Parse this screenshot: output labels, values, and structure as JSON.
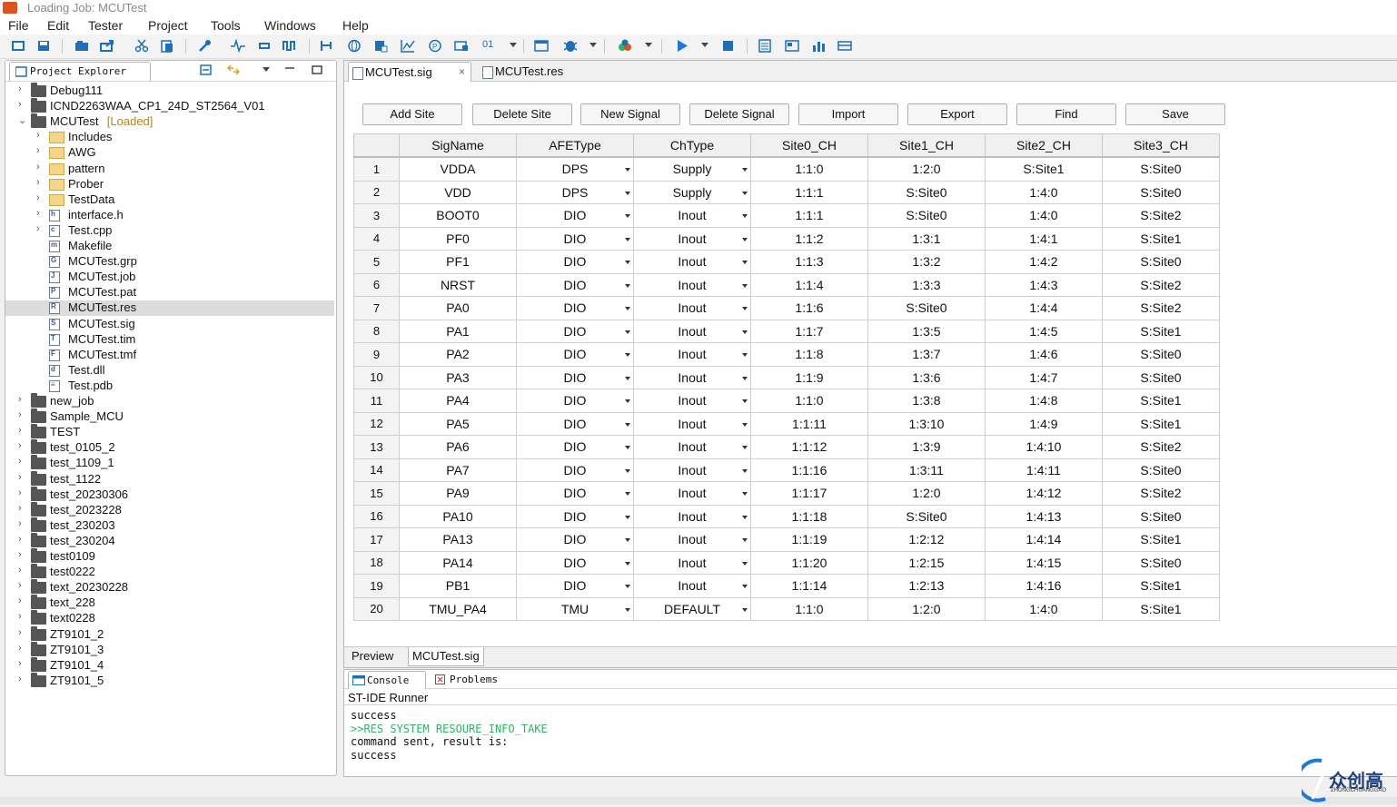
{
  "window": {
    "title": "Loading Job: MCUTest"
  },
  "menu": [
    "File",
    "Edit",
    "Tester",
    "Project",
    "Tools",
    "Windows",
    "Help"
  ],
  "toolbar": {
    "counter_label": "01"
  },
  "explorer": {
    "tab_label": "Project Explorer",
    "items": [
      {
        "label": "Debug111",
        "depth": 0,
        "expander": "collapsed",
        "icon": "project-folder"
      },
      {
        "label": "ICND2263WAA_CP1_24D_ST2564_V01",
        "depth": 0,
        "expander": "collapsed",
        "icon": "project-folder"
      },
      {
        "label": "MCUTest",
        "suffix": "[Loaded]",
        "depth": 0,
        "expander": "expanded",
        "icon": "project-folder"
      },
      {
        "label": "Includes",
        "depth": 1,
        "expander": "collapsed",
        "icon": "includes-folder"
      },
      {
        "label": "AWG",
        "depth": 1,
        "expander": "collapsed",
        "icon": "folder"
      },
      {
        "label": "pattern",
        "depth": 1,
        "expander": "collapsed",
        "icon": "folder"
      },
      {
        "label": "Prober",
        "depth": 1,
        "expander": "collapsed",
        "icon": "folder"
      },
      {
        "label": "TestData",
        "depth": 1,
        "expander": "collapsed",
        "icon": "folder"
      },
      {
        "label": "interface.h",
        "depth": 1,
        "expander": "collapsed",
        "icon": "file-h"
      },
      {
        "label": "Test.cpp",
        "depth": 1,
        "expander": "collapsed",
        "icon": "file-c"
      },
      {
        "label": "Makefile",
        "depth": 1,
        "expander": "none",
        "icon": "makefile"
      },
      {
        "label": "MCUTest.grp",
        "depth": 1,
        "expander": "none",
        "icon": "file-g"
      },
      {
        "label": "MCUTest.job",
        "depth": 1,
        "expander": "none",
        "icon": "file-j"
      },
      {
        "label": "MCUTest.pat",
        "depth": 1,
        "expander": "none",
        "icon": "file-p"
      },
      {
        "label": "MCUTest.res",
        "depth": 1,
        "expander": "none",
        "icon": "file-r",
        "selected": true
      },
      {
        "label": "MCUTest.sig",
        "depth": 1,
        "expander": "none",
        "icon": "file-s"
      },
      {
        "label": "MCUTest.tim",
        "depth": 1,
        "expander": "none",
        "icon": "file-t"
      },
      {
        "label": "MCUTest.tmf",
        "depth": 1,
        "expander": "none",
        "icon": "file-f"
      },
      {
        "label": "Test.dll",
        "depth": 1,
        "expander": "none",
        "icon": "file-dll"
      },
      {
        "label": "Test.pdb",
        "depth": 1,
        "expander": "none",
        "icon": "file-doc"
      },
      {
        "label": "new_job",
        "depth": 0,
        "expander": "collapsed",
        "icon": "project-folder"
      },
      {
        "label": "Sample_MCU",
        "depth": 0,
        "expander": "collapsed",
        "icon": "project-folder"
      },
      {
        "label": "TEST",
        "depth": 0,
        "expander": "collapsed",
        "icon": "project-folder"
      },
      {
        "label": "test_0105_2",
        "depth": 0,
        "expander": "collapsed",
        "icon": "project-folder"
      },
      {
        "label": "test_1109_1",
        "depth": 0,
        "expander": "collapsed",
        "icon": "project-folder"
      },
      {
        "label": "test_1122",
        "depth": 0,
        "expander": "collapsed",
        "icon": "project-folder"
      },
      {
        "label": "test_20230306",
        "depth": 0,
        "expander": "collapsed",
        "icon": "project-folder"
      },
      {
        "label": "test_2023228",
        "depth": 0,
        "expander": "collapsed",
        "icon": "project-folder"
      },
      {
        "label": "test_230203",
        "depth": 0,
        "expander": "collapsed",
        "icon": "project-folder"
      },
      {
        "label": "test_230204",
        "depth": 0,
        "expander": "collapsed",
        "icon": "project-folder"
      },
      {
        "label": "test0109",
        "depth": 0,
        "expander": "collapsed",
        "icon": "project-folder"
      },
      {
        "label": "test0222",
        "depth": 0,
        "expander": "collapsed",
        "icon": "project-folder"
      },
      {
        "label": "text_20230228",
        "depth": 0,
        "expander": "collapsed",
        "icon": "project-folder"
      },
      {
        "label": "text_228",
        "depth": 0,
        "expander": "collapsed",
        "icon": "project-folder"
      },
      {
        "label": "text0228",
        "depth": 0,
        "expander": "collapsed",
        "icon": "project-folder"
      },
      {
        "label": "ZT9101_2",
        "depth": 0,
        "expander": "collapsed",
        "icon": "project-folder"
      },
      {
        "label": "ZT9101_3",
        "depth": 0,
        "expander": "collapsed",
        "icon": "project-folder"
      },
      {
        "label": "ZT9101_4",
        "depth": 0,
        "expander": "collapsed",
        "icon": "project-folder"
      },
      {
        "label": "ZT9101_5",
        "depth": 0,
        "expander": "collapsed",
        "icon": "project-folder"
      }
    ]
  },
  "editor": {
    "tabs": [
      {
        "label": "MCUTest.sig",
        "active": true
      },
      {
        "label": "MCUTest.res",
        "active": false
      }
    ],
    "buttons": [
      "Add Site",
      "Delete Site",
      "New Signal",
      "Delete Signal",
      "Import",
      "Export",
      "Find",
      "Save"
    ],
    "columns": [
      "SigName",
      "AFEType",
      "ChType",
      "Site0_CH",
      "Site1_CH",
      "Site2_CH",
      "Site3_CH"
    ],
    "rows": [
      [
        "1",
        "VDDA",
        "DPS",
        "Supply",
        "1:1:0",
        "1:2:0",
        "S:Site1",
        "S:Site0"
      ],
      [
        "2",
        "VDD",
        "DPS",
        "Supply",
        "1:1:1",
        "S:Site0",
        "1:4:0",
        "S:Site0"
      ],
      [
        "3",
        "BOOT0",
        "DIO",
        "Inout",
        "1:1:1",
        "S:Site0",
        "1:4:0",
        "S:Site2"
      ],
      [
        "4",
        "PF0",
        "DIO",
        "Inout",
        "1:1:2",
        "1:3:1",
        "1:4:1",
        "S:Site1"
      ],
      [
        "5",
        "PF1",
        "DIO",
        "Inout",
        "1:1:3",
        "1:3:2",
        "1:4:2",
        "S:Site0"
      ],
      [
        "6",
        "NRST",
        "DIO",
        "Inout",
        "1:1:4",
        "1:3:3",
        "1:4:3",
        "S:Site2"
      ],
      [
        "7",
        "PA0",
        "DIO",
        "Inout",
        "1:1:6",
        "S:Site0",
        "1:4:4",
        "S:Site2"
      ],
      [
        "8",
        "PA1",
        "DIO",
        "Inout",
        "1:1:7",
        "1:3:5",
        "1:4:5",
        "S:Site1"
      ],
      [
        "9",
        "PA2",
        "DIO",
        "Inout",
        "1:1:8",
        "1:3:7",
        "1:4:6",
        "S:Site0"
      ],
      [
        "10",
        "PA3",
        "DIO",
        "Inout",
        "1:1:9",
        "1:3:6",
        "1:4:7",
        "S:Site0"
      ],
      [
        "11",
        "PA4",
        "DIO",
        "Inout",
        "1:1:0",
        "1:3:8",
        "1:4:8",
        "S:Site1"
      ],
      [
        "12",
        "PA5",
        "DIO",
        "Inout",
        "1:1:11",
        "1:3:10",
        "1:4:9",
        "S:Site1"
      ],
      [
        "13",
        "PA6",
        "DIO",
        "Inout",
        "1:1:12",
        "1:3:9",
        "1:4:10",
        "S:Site2"
      ],
      [
        "14",
        "PA7",
        "DIO",
        "Inout",
        "1:1:16",
        "1:3:11",
        "1:4:11",
        "S:Site0"
      ],
      [
        "15",
        "PA9",
        "DIO",
        "Inout",
        "1:1:17",
        "1:2:0",
        "1:4:12",
        "S:Site2"
      ],
      [
        "16",
        "PA10",
        "DIO",
        "Inout",
        "1:1:18",
        "S:Site0",
        "1:4:13",
        "S:Site0"
      ],
      [
        "17",
        "PA13",
        "DIO",
        "Inout",
        "1:1:19",
        "1:2:12",
        "1:4:14",
        "S:Site1"
      ],
      [
        "18",
        "PA14",
        "DIO",
        "Inout",
        "1:1:20",
        "1:2:15",
        "1:4:15",
        "S:Site0"
      ],
      [
        "19",
        "PB1",
        "DIO",
        "Inout",
        "1:1:14",
        "1:2:13",
        "1:4:16",
        "S:Site1"
      ],
      [
        "20",
        "TMU_PA4",
        "TMU",
        "DEFAULT",
        "1:1:0",
        "1:2:0",
        "1:4:0",
        "S:Site1"
      ]
    ],
    "bottom_tabs": [
      "Preview",
      "MCUTest.sig"
    ]
  },
  "console": {
    "tabs": [
      "Console",
      "Problems"
    ],
    "title": "ST-IDE Runner",
    "lines": [
      {
        "text": "success",
        "style": "normal"
      },
      {
        "text": ">>RES SYSTEM RESOURE_INFO_TAKE",
        "style": "green"
      },
      {
        "text": "command sent, result is:",
        "style": "normal"
      },
      {
        "text": "success",
        "style": "normal"
      }
    ]
  },
  "logo": {
    "name": "众创高",
    "sub": "ZHONGCHUANGGAO"
  },
  "colors": {
    "console_command": "#2db368",
    "loaded_tag": "#b8860b",
    "play": "#1d78d6",
    "app_icon": "#d9541e"
  }
}
